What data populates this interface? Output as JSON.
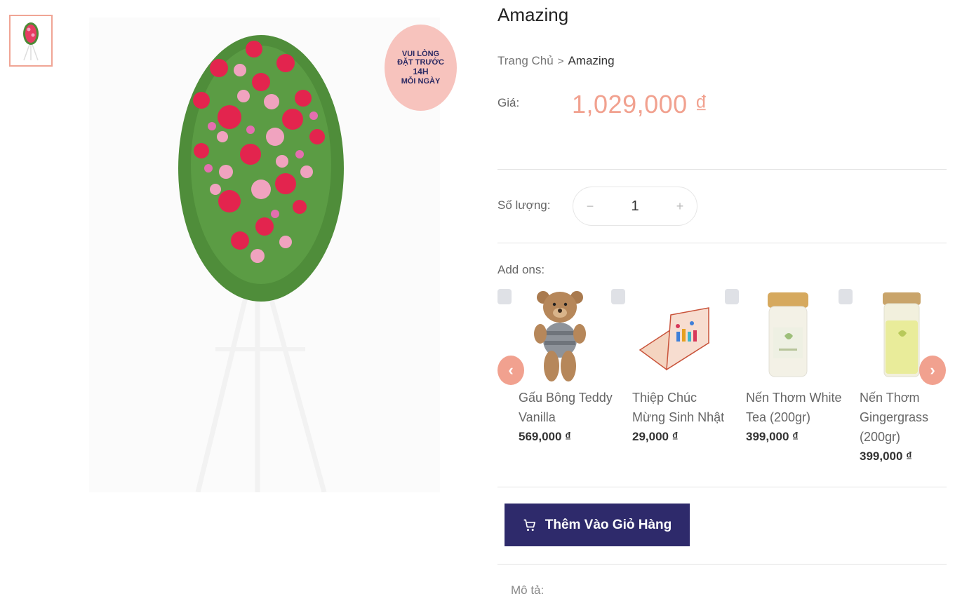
{
  "gallery": {
    "badge_line1": "VUI LÒNG",
    "badge_line2": "ĐẶT TRƯỚC",
    "badge_line3": "14H",
    "badge_line4": "MỖI NGÀY"
  },
  "product": {
    "title": "Amazing",
    "breadcrumb": {
      "home": "Trang Chủ",
      "separator": ">",
      "current": "Amazing"
    },
    "price_label": "Giá:",
    "price": "1,029,000 ₫",
    "quantity_label": "Số lượng:",
    "quantity_minus": "−",
    "quantity_value": "1",
    "quantity_plus": "+",
    "addons_label": "Add ons:"
  },
  "addons": [
    {
      "name": "Gấu Bông Teddy Vanilla",
      "price": "569,000 ₫",
      "icon": "teddy-bear"
    },
    {
      "name": "Thiệp Chúc Mừng Sinh Nhật",
      "price": "29,000 ₫",
      "icon": "greeting-card"
    },
    {
      "name": "Nến Thơm White Tea (200gr)",
      "price": "399,000 ₫",
      "icon": "candle-jar"
    },
    {
      "name": "Nến Thơm Gingergrass (200gr)",
      "price": "399,000 ₫",
      "icon": "candle-jar"
    }
  ],
  "carousel": {
    "prev": "‹",
    "next": "›"
  },
  "actions": {
    "add_to_cart": "Thêm Vào Giỏ Hàng"
  },
  "description_label": "Mô tả:",
  "colors": {
    "accent": "#f1a18f",
    "button": "#2e2a6b",
    "badge": "#f7c3bd"
  }
}
